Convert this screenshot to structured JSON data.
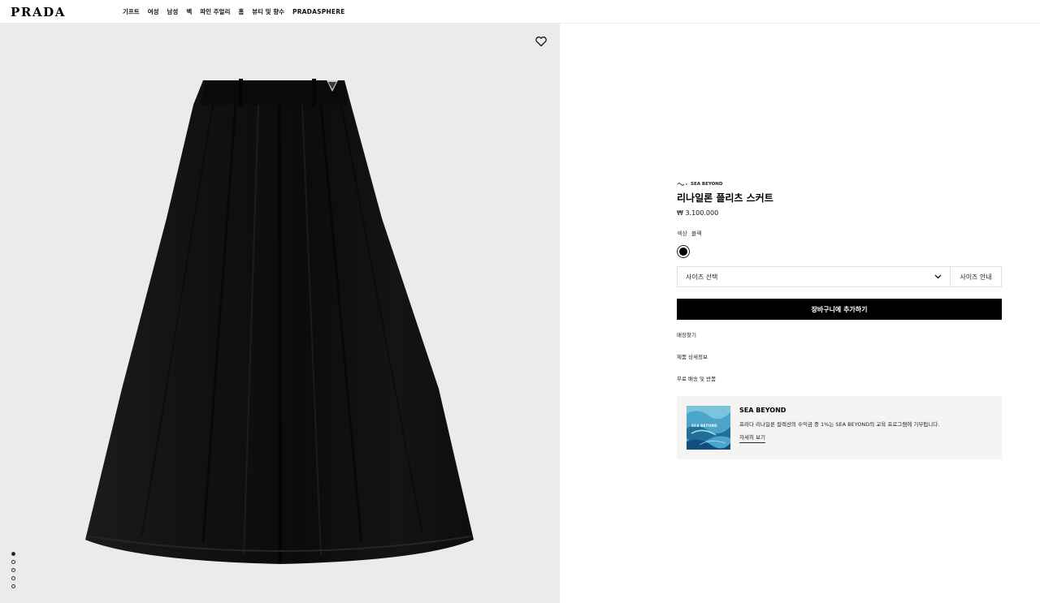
{
  "header": {
    "logo": "PRADA",
    "nav": [
      "기프트",
      "여성",
      "남성",
      "백",
      "파인 주얼리",
      "홈",
      "뷰티 및 향수",
      "PRADASPHERE"
    ]
  },
  "gallery": {
    "image_count": 5,
    "active_index": 0
  },
  "product": {
    "tag": "SEA BEYOND",
    "name": "리나일론 플리츠 스커트",
    "price": "₩ 3.100.000",
    "color_label": "색상",
    "color_value": "블랙",
    "swatch_color": "#000000",
    "size_placeholder": "사이즈 선택",
    "size_guide": "사이즈 안내",
    "add_to_cart": "장바구니에 추가하기",
    "links": [
      "매장찾기",
      "제품 상세정보",
      "무료 배송 및 반품"
    ]
  },
  "sea_beyond": {
    "image_label": "SEA BEYOND",
    "title": "SEA BEYOND",
    "description": "프라다 리나일론 컬렉션의 수익금 중 1%는 SEA BEYOND의 교육 프로그램에 기부됩니다.",
    "more": "자세히 보기"
  },
  "colors": {
    "accent": "#000000",
    "panel_bg": "#ebebed",
    "sea_box_bg": "#f4f4f4"
  }
}
